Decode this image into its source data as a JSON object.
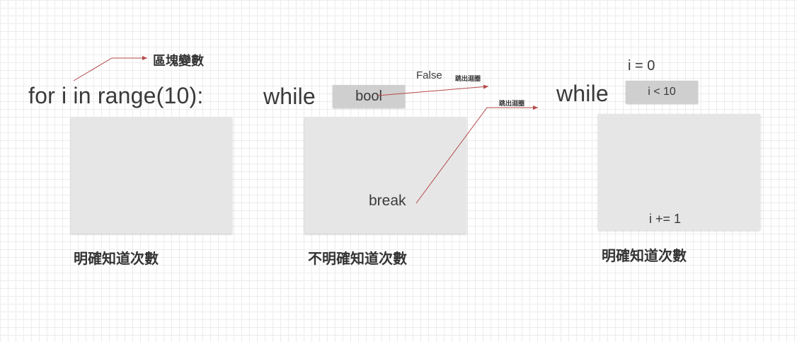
{
  "panel_for": {
    "code": "for i in range(10):",
    "annotation": "區塊變數",
    "caption": "明確知道次數"
  },
  "panel_while_break": {
    "keyword": "while",
    "condition": "bool",
    "false_label": "False",
    "exit_label_1": "跳出迴圈",
    "exit_label_2": "跳出迴圈",
    "break_text": "break",
    "caption": "不明確知道次數"
  },
  "panel_while_count": {
    "init": "i = 0",
    "keyword": "while",
    "condition": "i < 10",
    "increment": "i += 1",
    "caption": "明確知道次數"
  },
  "colors": {
    "arrow": "#b5484a",
    "block": "#e6e6e6",
    "condition_box": "#cfcfcf",
    "grid": "#ececec"
  }
}
